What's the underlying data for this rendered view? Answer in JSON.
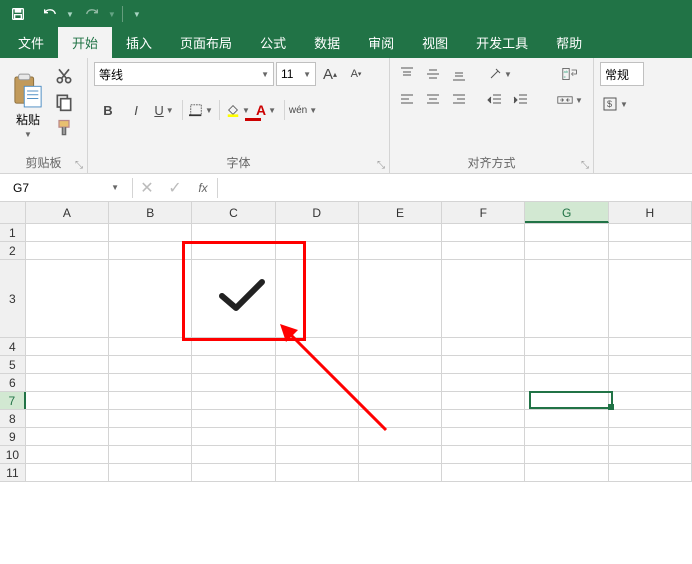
{
  "qat": {
    "save": "save-icon",
    "undo": "undo-icon",
    "redo": "redo-icon"
  },
  "tabs": {
    "file": "文件",
    "home": "开始",
    "insert": "插入",
    "layout": "页面布局",
    "formulas": "公式",
    "data": "数据",
    "review": "审阅",
    "view": "视图",
    "developer": "开发工具",
    "help": "帮助"
  },
  "ribbon": {
    "clipboard": {
      "paste": "粘贴",
      "label": "剪贴板"
    },
    "font": {
      "name": "等线",
      "size": "11",
      "bold": "B",
      "italic": "I",
      "underline": "U",
      "wen": "wén",
      "label": "字体"
    },
    "alignment": {
      "label": "对齐方式"
    },
    "number": {
      "format": "常规"
    }
  },
  "namebox": "G7",
  "fx": "fx",
  "columns": [
    "A",
    "B",
    "C",
    "D",
    "E",
    "F",
    "G",
    "H"
  ],
  "rows": [
    "1",
    "2",
    "3",
    "4",
    "5",
    "6",
    "7",
    "8",
    "9",
    "10",
    "11"
  ],
  "row_heights": {
    "1": 18,
    "2": 18,
    "3": 78,
    "4": 18,
    "5": 18,
    "6": 18,
    "7": 18,
    "8": 18,
    "9": 18,
    "10": 18,
    "11": 18
  },
  "selected": {
    "col": "G",
    "row": "7"
  },
  "annotation": {
    "checkmark_cell": "C3 area",
    "arrow_color": "#ff0000"
  }
}
